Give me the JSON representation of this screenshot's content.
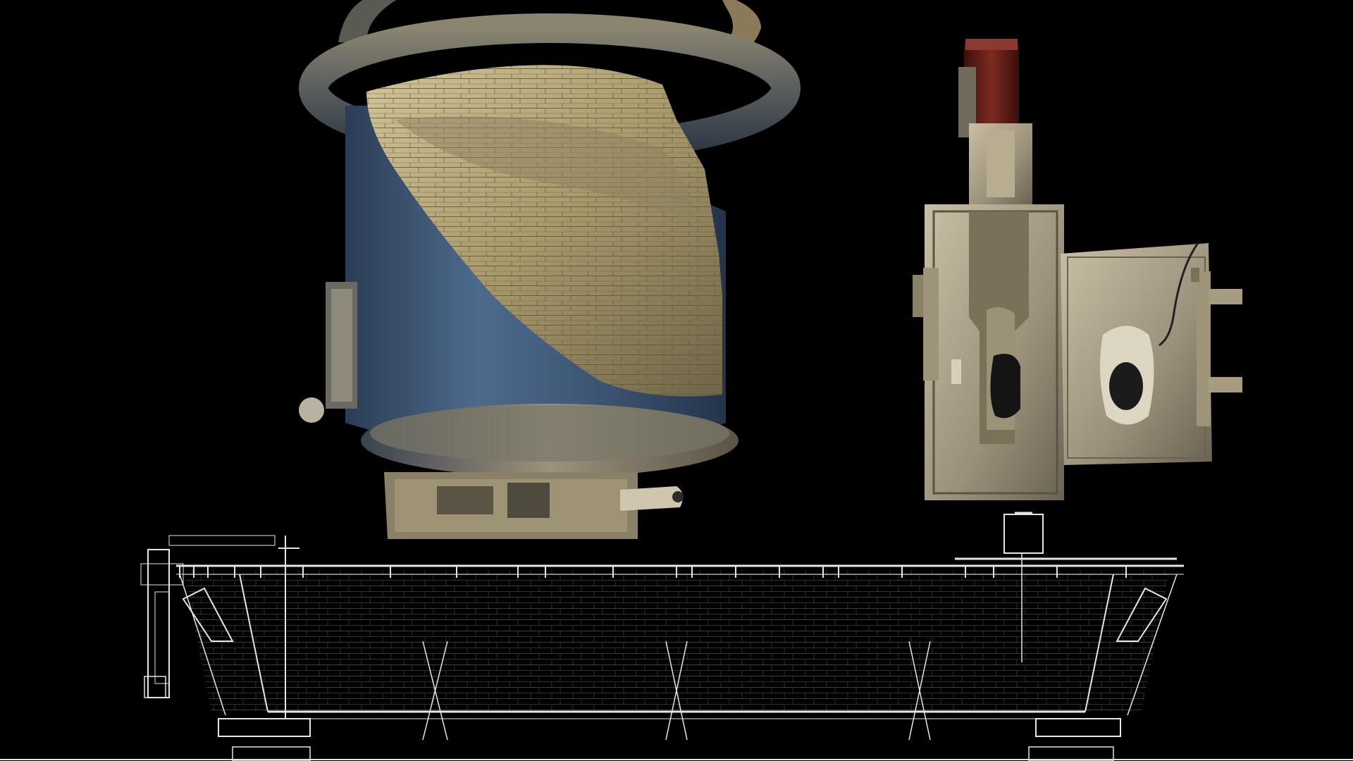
{
  "scene": {
    "components": [
      {
        "id": "ladle",
        "kind": "refractory-lined-ladle-cutaway"
      },
      {
        "id": "slide-gate",
        "kind": "slide-gate-valve-cutaway"
      },
      {
        "id": "tundish",
        "kind": "tundish-wireframe-blueprint"
      }
    ]
  },
  "palette": {
    "background": "#000000",
    "shell_blue": "#3f5a78",
    "brick_tan": "#b0a37a",
    "steel_gray": "#a39a84",
    "actuator_red": "#6b1e1a",
    "wire_white": "#e8e8e8"
  }
}
